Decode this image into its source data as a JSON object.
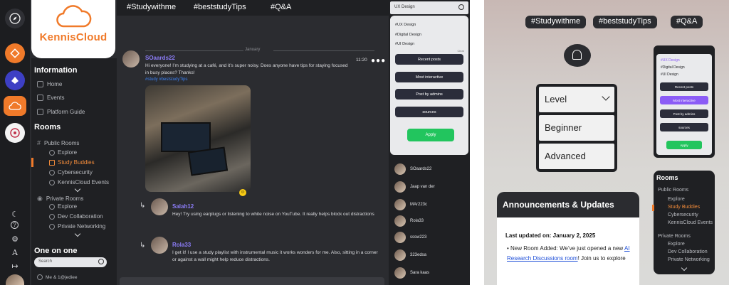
{
  "left": {
    "logo": "KennisCloud",
    "information": {
      "heading": "Information",
      "items": [
        "Home",
        "Events",
        "Platform Guide"
      ]
    },
    "rooms": {
      "heading": "Rooms",
      "public_label": "Public Rooms",
      "public_items": [
        "Explore",
        "Study Buddies",
        "Cybersecurity",
        "KennisCloud Events"
      ],
      "private_label": "Private Rooms",
      "private_items": [
        "Explore",
        "Dev Collaboration",
        "Private Networking"
      ]
    },
    "one_on_one": {
      "heading": "One on one",
      "search_placeholder": "Search",
      "first_item": "Me & 1@jediee"
    },
    "topbar": {
      "tags": [
        "#Studywithme",
        "#beststudyTips",
        "#Q&A"
      ]
    },
    "chat": {
      "date_divider": "January",
      "messages": [
        {
          "user": "SOaards22",
          "time": "11:20",
          "text": "Hi everyone! I’m studying at a café, and it’s super noisy. Does anyone have tips for staying focused in busy places? Thanks!",
          "hashtags": "#study #beststudyTips"
        },
        {
          "user": "Salah12",
          "text": "Hey! Try using earplugs or listening to white noise on YouTube. It really helps block out distractions"
        },
        {
          "user": "Rola33",
          "text": "I get it! I use a study playlist with instrumental music it works wonders for me. Also, sitting in a corner or against a wall might help reduce distractions."
        }
      ]
    },
    "filter": {
      "search_text": "UX Design",
      "tags": [
        "#UX Design",
        "#Digital Design",
        "#UI Design"
      ],
      "clear": "Clear",
      "buttons": [
        "Recent posts",
        "Most interactive",
        "Post by admins",
        "sources"
      ],
      "apply": "Apply"
    },
    "users": [
      "SOaards22",
      "Jaap van der",
      "MAr223c",
      "Rola33",
      "sssw223",
      "323edsa",
      "Sara kaas"
    ]
  },
  "right": {
    "tags": [
      "#Studywithme",
      "#beststudyTips",
      "#Q&A"
    ],
    "level": {
      "label": "Level",
      "options": [
        "Beginner",
        "Advanced"
      ]
    },
    "filter_mini": {
      "tags": [
        "#UX Design",
        "#Digital Design",
        "#UI Design"
      ],
      "buttons": [
        "Recent posts",
        "Most interactive",
        "Post by admins",
        "sources"
      ],
      "apply": "Apply"
    },
    "rooms": {
      "heading": "Rooms",
      "public_label": "Public Rooms",
      "public_items": [
        "Explore",
        "Study Buddies",
        "Cybersecurity",
        "KennisCloud Events"
      ],
      "private_label": "Private Rooms",
      "private_items": [
        "Explore",
        "Dev Collaboration",
        "Private Networking"
      ]
    },
    "announcements": {
      "title": "Announcements & Updates",
      "date": "Last updated on: January 2, 2025",
      "text_prefix": "New Room Added: We’ve just opened a new ",
      "link": "AI Research Discussions room",
      "text_suffix": "! Join us to explore"
    }
  },
  "colors": {
    "accent": "#f07a2a",
    "purple": "#8b5cf6",
    "green": "#22c55e",
    "dark": "#2b2c30"
  }
}
